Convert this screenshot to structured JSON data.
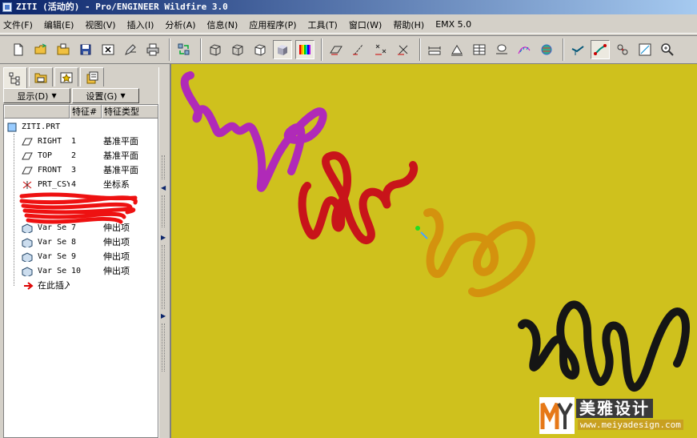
{
  "window": {
    "title": "ZITI (活动的) - Pro/ENGINEER Wildfire 3.0"
  },
  "menubar": {
    "items": [
      "文件(F)",
      "编辑(E)",
      "视图(V)",
      "插入(I)",
      "分析(A)",
      "信息(N)",
      "应用程序(P)",
      "工具(T)",
      "窗口(W)",
      "帮助(H)",
      "EMX 5.0"
    ]
  },
  "toolbar": {
    "groups": [
      [
        "new-icon",
        "open-icon",
        "open-folder-icon",
        "save-icon",
        "close-window-icon",
        "edit-icon",
        "print-icon"
      ],
      [
        "regenerate-icon"
      ],
      [
        "wireframe-icon",
        "hidden-line-icon",
        "no-hidden-icon",
        "shading-icon",
        "color-icon"
      ],
      [
        "datum-plane-icon",
        "datum-axis-icon",
        "datum-point-icon",
        "coordinate-system-icon"
      ],
      [
        "measure-icon",
        "area-icon",
        "table-icon",
        "mass-icon",
        "curvature-icon",
        "globe-icon"
      ],
      [
        "orient-icon",
        "select-icon",
        "select-filter-icon",
        "view-icon",
        "zoom-icon"
      ]
    ]
  },
  "panel": {
    "show_label": "显示(D)",
    "settings_label": "设置(G)",
    "col_feature_num": "特征#",
    "col_feature_type": "特征类型",
    "root": "ZITI.PRT",
    "rows": [
      {
        "name": "RIGHT",
        "num": "1",
        "type": "基准平面",
        "icon": "datum-plane-icon"
      },
      {
        "name": "TOP",
        "num": "2",
        "type": "基准平面",
        "icon": "datum-plane-icon"
      },
      {
        "name": "FRONT",
        "num": "3",
        "type": "基准平面",
        "icon": "datum-plane-icon"
      },
      {
        "name": "PRT_CSYS",
        "num": "4",
        "type": "坐标系",
        "icon": "coordinate-system-icon"
      },
      {
        "name": "Var Se",
        "num": "7",
        "type": "伸出项",
        "icon": "sweep-feature-icon"
      },
      {
        "name": "Var Se",
        "num": "8",
        "type": "伸出项",
        "icon": "sweep-feature-icon"
      },
      {
        "name": "Var Se",
        "num": "9",
        "type": "伸出项",
        "icon": "sweep-feature-icon"
      },
      {
        "name": "Var Se",
        "num": "10",
        "type": "伸出项",
        "icon": "sweep-feature-icon"
      }
    ],
    "insert_here": "在此插入"
  },
  "watermark": {
    "text": "美雅设计",
    "url": "www.meiyadesign.com"
  },
  "colors": {
    "viewport_bg": "#cfc11d",
    "stroke_purple": "#b02ab8",
    "stroke_red": "#c8141a",
    "stroke_gold": "#d4920e",
    "stroke_black": "#151515"
  }
}
